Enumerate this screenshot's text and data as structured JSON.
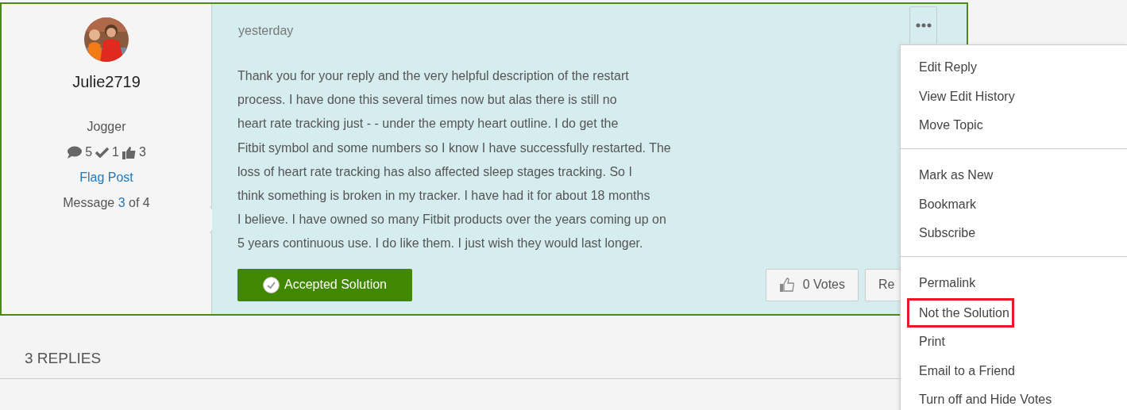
{
  "post": {
    "author": {
      "username": "Julie2719",
      "rank": "Jogger",
      "stats": [
        {
          "kind": "messages",
          "value": "5"
        },
        {
          "kind": "solutions",
          "value": "1"
        },
        {
          "kind": "kudos",
          "value": "3"
        }
      ],
      "flag_link": "Flag Post",
      "message_counter": {
        "prefix": "Message ",
        "link": "3",
        "suffix": " of 4"
      }
    },
    "date": "yesterday",
    "body_lines": [
      "Thank you for your reply and the very helpful description of the restart",
      "process. I have done this several times now but alas there is still no",
      "heart rate tracking just - - under the empty heart outline. I do get the",
      "Fitbit symbol and some numbers so I know I have successfully restarted. The",
      "loss of heart rate tracking has also affected sleep stages tracking. So I",
      "think something is broken in my tracker. I have had it for about 18 months",
      "I believe. I have owned so many Fitbit products over the years coming up on",
      "5 years continuous use. I do like them. I just wish they would last longer."
    ],
    "accepted_button": "Accepted Solution",
    "votes_button": "0 Votes",
    "reply_button": "Re",
    "options_menu": {
      "expanded": true,
      "groups": [
        [
          {
            "label": "Edit Reply",
            "highlighted": false
          },
          {
            "label": "View Edit History",
            "highlighted": false
          },
          {
            "label": "Move Topic",
            "highlighted": false
          }
        ],
        [
          {
            "label": "Mark as New",
            "highlighted": false
          },
          {
            "label": "Bookmark",
            "highlighted": false
          },
          {
            "label": "Subscribe",
            "highlighted": false
          }
        ],
        [
          {
            "label": "Permalink",
            "highlighted": false
          },
          {
            "label": "Not the Solution",
            "highlighted": true
          },
          {
            "label": "Print",
            "highlighted": false
          },
          {
            "label": "Email to a Friend",
            "highlighted": false
          },
          {
            "label": "Turn off and Hide Votes",
            "highlighted": false
          }
        ]
      ]
    }
  },
  "replies_heading": "3 REPLIES"
}
